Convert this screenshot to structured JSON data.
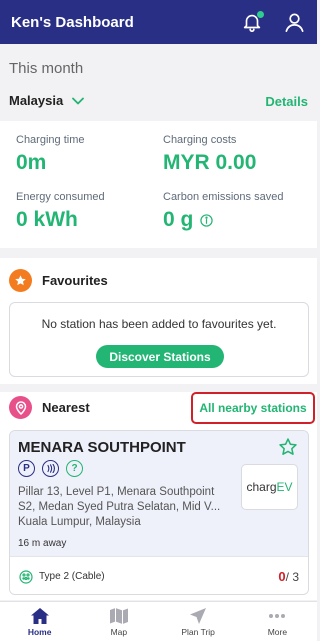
{
  "header": {
    "title": "Ken's Dashboard"
  },
  "month": {
    "title": "This month",
    "region": "Malaysia",
    "details_label": "Details"
  },
  "stats": {
    "charging_time": {
      "label": "Charging time",
      "value": "0m"
    },
    "charging_costs": {
      "label": "Charging costs",
      "value": "MYR 0.00"
    },
    "energy": {
      "label": "Energy consumed",
      "value": "0 kWh"
    },
    "carbon": {
      "label": "Carbon emissions saved",
      "value": "0 g"
    }
  },
  "favourites": {
    "title": "Favourites",
    "empty_text": "No station has been added to favourites yet.",
    "discover_label": "Discover Stations"
  },
  "nearest": {
    "title": "Nearest",
    "all_link": "All nearby stations",
    "station": {
      "name": "MENARA SOUTHPOINT",
      "address": "Pillar 13, Level P1, Menara Southpoint S2, Medan Syed Putra Selatan, Mid V... Kuala Lumpur, Malaysia",
      "distance": "16 m away",
      "operator_logo_a": "charg",
      "operator_logo_b": "EV",
      "amenities": [
        "parking-icon",
        "contactless-icon",
        "help-icon"
      ],
      "plug_type": "Type 2 (Cable)",
      "available": "0",
      "total": "/ 3"
    }
  },
  "tabs": [
    {
      "label": "Home",
      "icon": "home-icon",
      "active": true
    },
    {
      "label": "Map",
      "icon": "map-icon",
      "active": false
    },
    {
      "label": "Plan Trip",
      "icon": "navigation-icon",
      "active": false
    },
    {
      "label": "More",
      "icon": "more-icon",
      "active": false
    }
  ],
  "colors": {
    "header": "#2a2f86",
    "accent": "#22b573",
    "alert": "#d0202a",
    "favourite_badge": "#f47c20",
    "nearest_badge": "#e8508a"
  }
}
